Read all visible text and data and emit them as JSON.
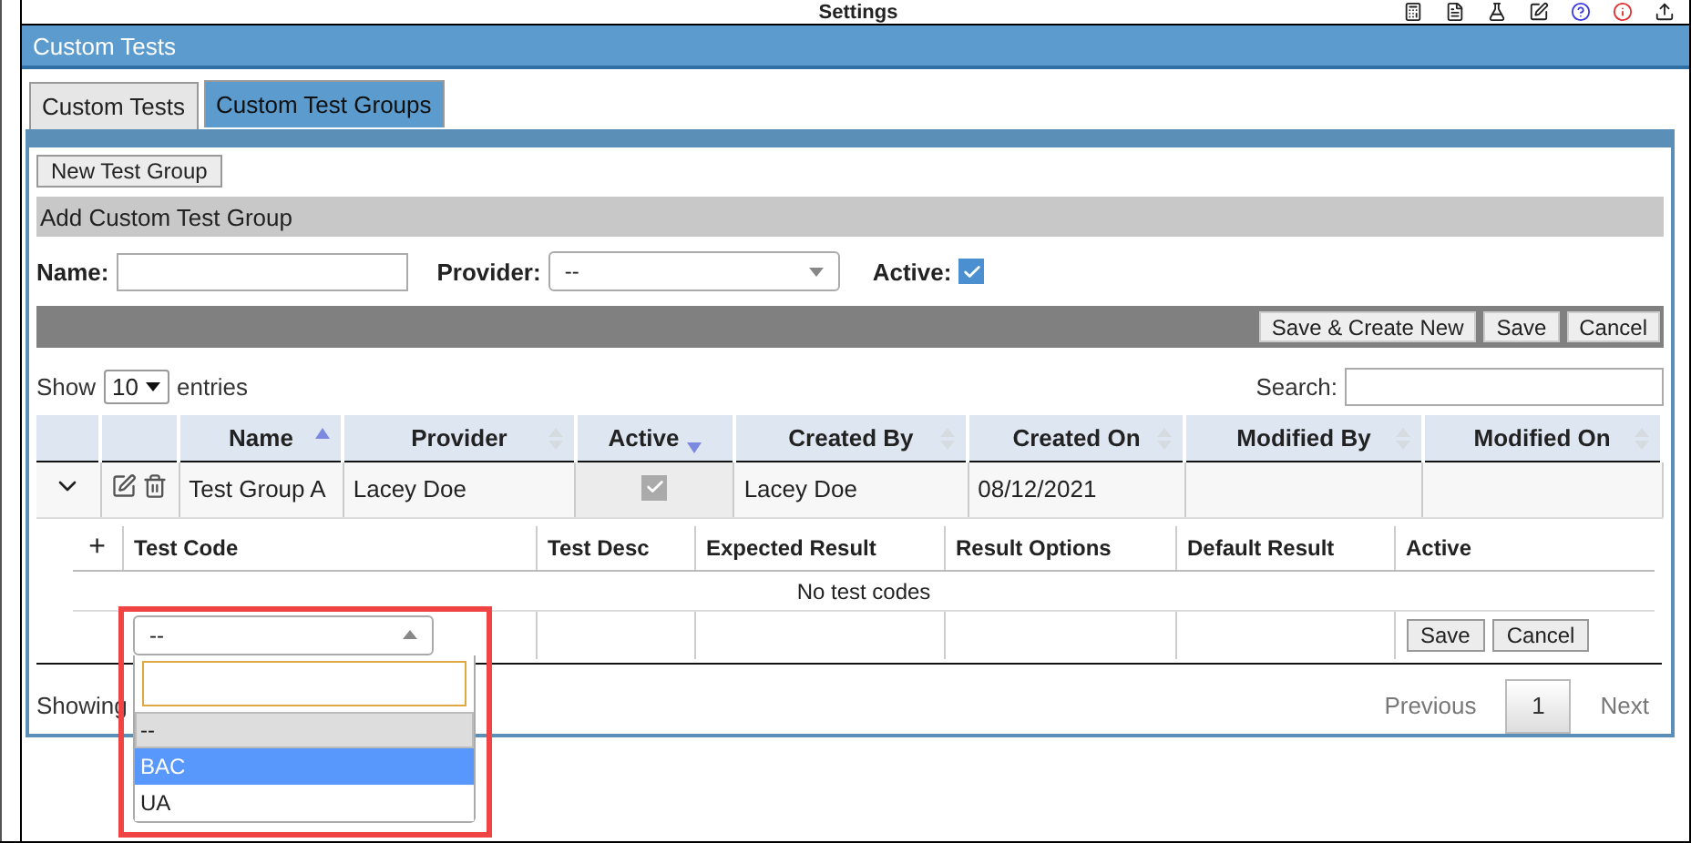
{
  "app_bar": {
    "title": "Settings"
  },
  "header": {
    "title": "Custom Tests"
  },
  "tabs": [
    {
      "label": "Custom Tests",
      "selected": false
    },
    {
      "label": "Custom Test Groups",
      "selected": true
    }
  ],
  "new_button": "New Test Group",
  "form": {
    "title": "Add Custom Test Group",
    "name_label": "Name:",
    "provider_label": "Provider:",
    "provider_value": "--",
    "active_label": "Active:",
    "active_checked": true
  },
  "form_actions": [
    "Save & Create New",
    "Save",
    "Cancel"
  ],
  "length": {
    "show": "Show",
    "value": "10",
    "entries": "entries"
  },
  "search_label": "Search:",
  "table": {
    "columns": [
      {
        "kind": "plain"
      },
      {
        "kind": "plain"
      },
      {
        "label": "Name",
        "kind": "ascending"
      },
      {
        "label": "Provider",
        "kind": "sortable"
      },
      {
        "label": "Active",
        "kind": "descending"
      },
      {
        "label": "Created By",
        "kind": "sortable"
      },
      {
        "label": "Created On",
        "kind": "sortable"
      },
      {
        "label": "Modified By",
        "kind": "sortable"
      },
      {
        "label": "Modified On",
        "kind": "sortable"
      }
    ],
    "rows": [
      {
        "name": "Test Group A",
        "provider": "Lacey Doe",
        "active": true,
        "created_by": "Lacey Doe",
        "created_on": "08/12/2021",
        "expanded": true
      }
    ]
  },
  "sub_table": {
    "add": "+",
    "columns": [
      "Test Code",
      "Test Desc",
      "Expected Result",
      "Result Options",
      "Default Result",
      "Active"
    ],
    "empty": "No test codes",
    "actions": [
      "Save",
      "Cancel"
    ]
  },
  "code_select": {
    "value": "--",
    "open": true,
    "options": [
      {
        "label": "--",
        "selected": true,
        "highlighted": false
      },
      {
        "label": "BAC",
        "selected": false,
        "highlighted": true
      },
      {
        "label": "UA",
        "selected": false,
        "highlighted": false
      }
    ]
  },
  "footer": {
    "info": "Showing",
    "previous": "Previous",
    "next": "Next",
    "pages": [
      {
        "label": "1",
        "selected": true
      }
    ]
  }
}
